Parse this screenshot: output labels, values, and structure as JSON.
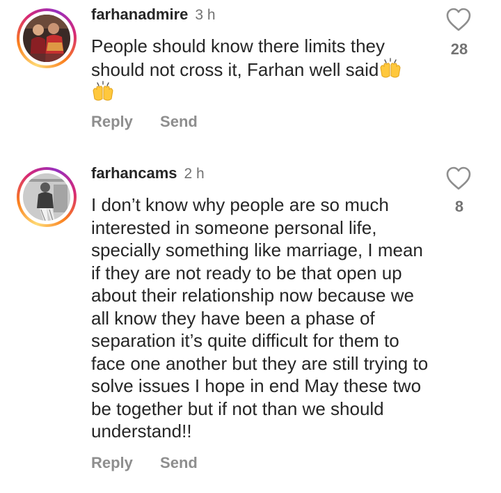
{
  "comments": [
    {
      "username": "farhanadmire",
      "time": "3 h",
      "text": "People should know there limits they should not cross it, Farhan well said",
      "emoji": [
        "raising-hands",
        "raising-hands"
      ],
      "likes": "28",
      "reply_label": "Reply",
      "send_label": "Send"
    },
    {
      "username": "farhancams",
      "time": "2 h",
      "text": "I don’t know why people are so much interested in someone personal life, specially something like marriage, I mean if they are not ready to be that open up about their relationship now because we all know they have been a phase of separation it’s quite difficult for them to face one another but they are still trying to solve issues I hope in end May these two be together but if not than we should understand!!",
      "likes": "8",
      "reply_label": "Reply",
      "send_label": "Send"
    }
  ],
  "colors": {
    "text": "#262626",
    "muted": "#737373",
    "action": "#8e8e8e",
    "ring": [
      "#feda75",
      "#fa7e1e",
      "#d62976",
      "#962fbf"
    ]
  }
}
